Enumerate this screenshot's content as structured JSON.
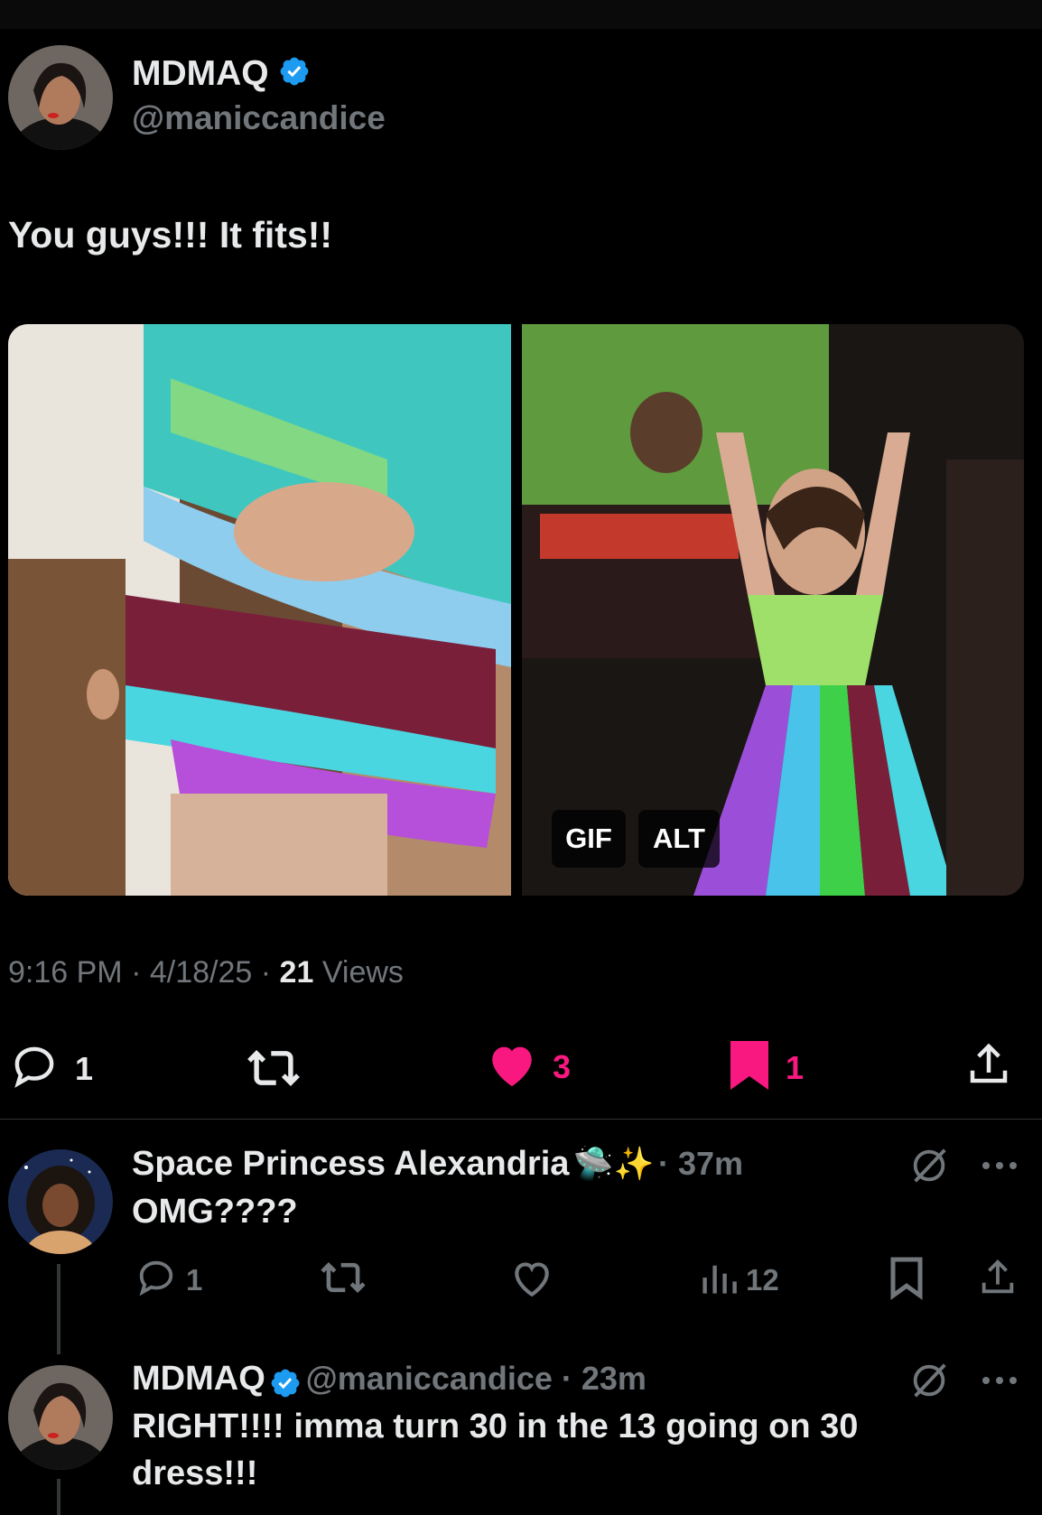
{
  "tweet": {
    "author_name": "MDMAQ",
    "author_handle": "@maniccandice",
    "text": "You guys!!! It fits!!",
    "time": "9:16 PM",
    "date": "4/18/25",
    "views_count": "21",
    "views_label": "Views",
    "media": {
      "gif_badge": "GIF",
      "alt_badge": "ALT"
    },
    "actions": {
      "reply_count": "1",
      "like_count": "3",
      "bookmark_count": "1"
    }
  },
  "replies": [
    {
      "author_name": "Space Princess Alexandria",
      "emoji": "🛸✨",
      "time": "37m",
      "text": "OMG????",
      "reply_count": "1",
      "views_count": "12"
    },
    {
      "author_name": "MDMAQ",
      "author_handle": "@maniccandice",
      "time": "23m",
      "text": "RIGHT!!!! imma turn 30 in the 13 going on 30 dress!!!"
    }
  ],
  "colors": {
    "background": "#000000",
    "text": "#e7e9ea",
    "muted": "#71767b",
    "verified": "#1d9bf0",
    "pink": "#f91880"
  },
  "icons": [
    "verified-icon",
    "reply-icon",
    "retweet-icon",
    "heart-icon",
    "bookmark-icon",
    "share-icon",
    "views-icon",
    "grok-icon",
    "more-icon"
  ]
}
